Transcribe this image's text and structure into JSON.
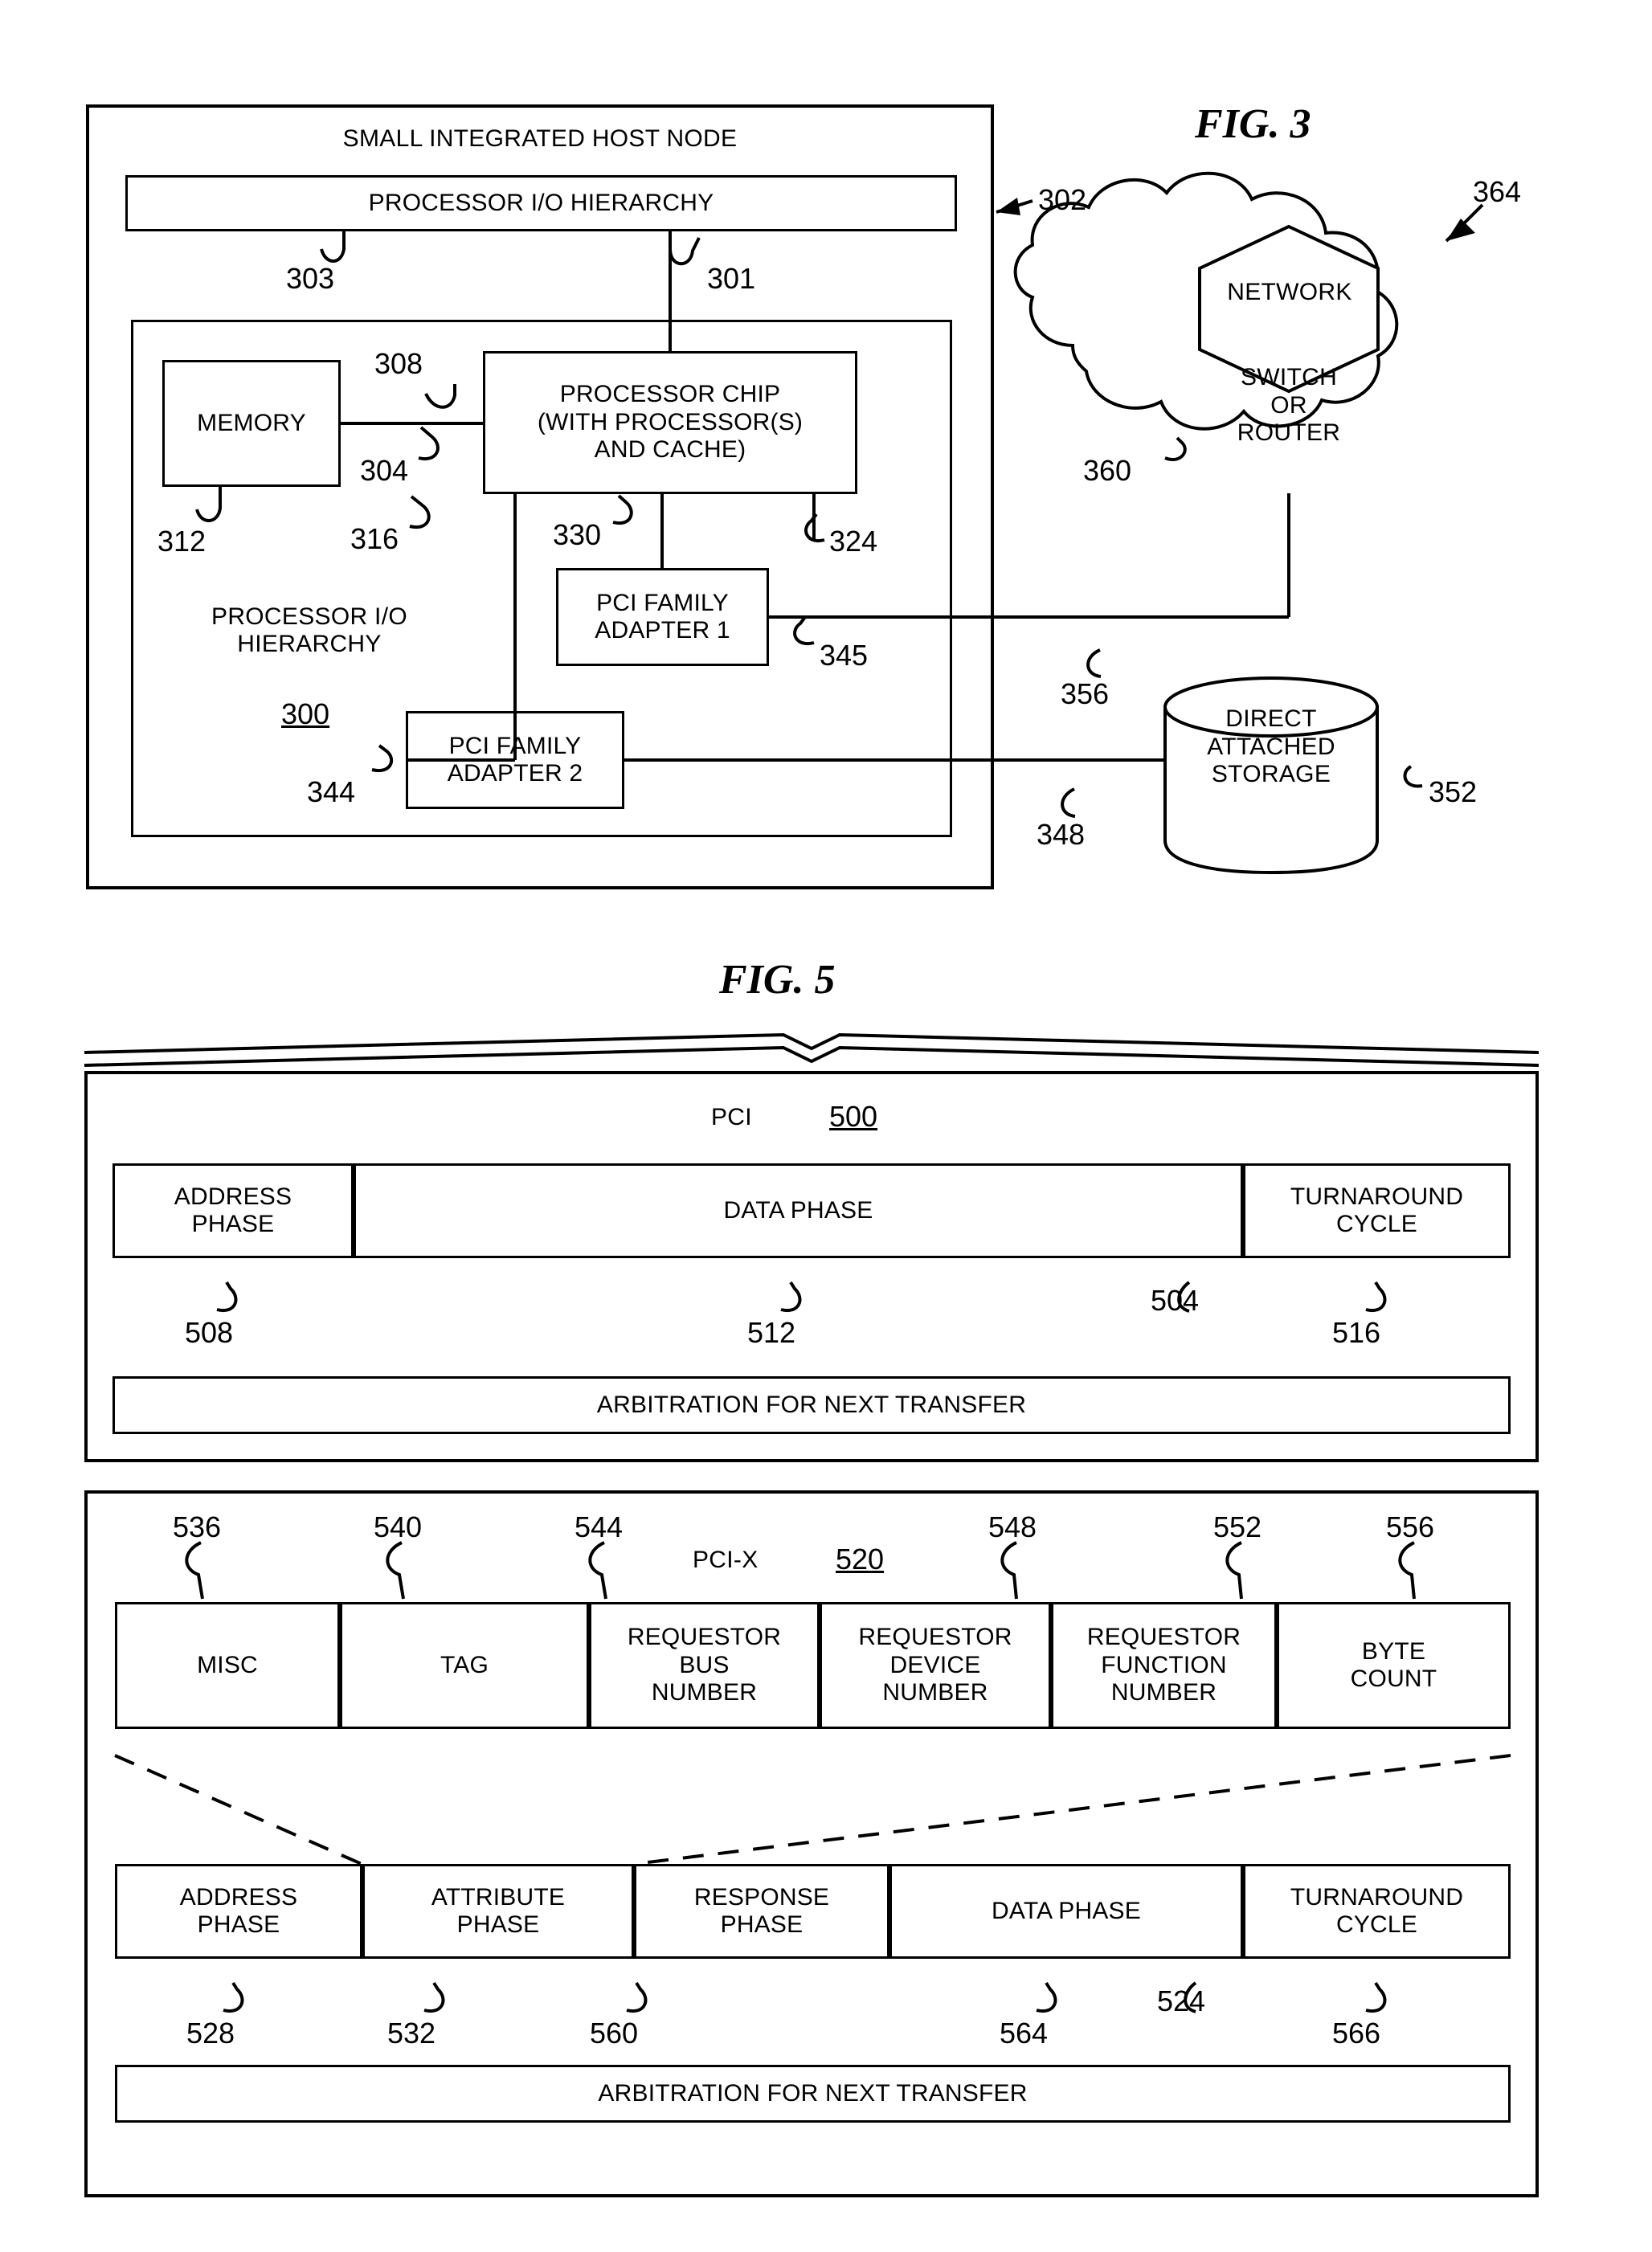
{
  "figures": {
    "fig3": {
      "title": "FIG. 3",
      "outer_label": "SMALL INTEGRATED HOST NODE",
      "processor_io_hierarchy_top": "PROCESSOR I/O HIERARCHY",
      "memory": "MEMORY",
      "processor_chip": "PROCESSOR CHIP\n(WITH PROCESSOR(S)\nAND CACHE)",
      "pci_adapter_1": "PCI FAMILY\nADAPTER 1",
      "pci_adapter_2": "PCI FAMILY\nADAPTER 2",
      "processor_io_hierarchy_inner": "PROCESSOR I/O\nHIERARCHY",
      "hierarchy_number": "300",
      "network": "NETWORK",
      "switch_or_router": "SWITCH\nOR\nROUTER",
      "direct_attached_storage": "DIRECT\nATTACHED\nSTORAGE",
      "refs": {
        "r302": "302",
        "r303": "303",
        "r301": "301",
        "r308": "308",
        "r304": "304",
        "r312": "312",
        "r316": "316",
        "r330": "330",
        "r324": "324",
        "r345": "345",
        "r344": "344",
        "r364": "364",
        "r360": "360",
        "r356": "356",
        "r348": "348",
        "r352": "352"
      }
    },
    "fig5": {
      "title": "FIG. 5",
      "pci": {
        "label": "PCI",
        "number": "500",
        "cells": [
          {
            "text": "ADDRESS\nPHASE",
            "ref": "508"
          },
          {
            "text": "DATA PHASE",
            "ref": "512"
          },
          {
            "text": "TURNAROUND\nCYCLE",
            "ref": "516"
          }
        ],
        "row_ref": "504",
        "arbitration": "ARBITRATION FOR NEXT TRANSFER"
      },
      "pcix": {
        "label": "PCI-X",
        "number": "520",
        "attribute_cells": [
          {
            "text": "MISC",
            "ref": "536"
          },
          {
            "text": "TAG",
            "ref": "540"
          },
          {
            "text": "REQUESTOR\nBUS\nNUMBER",
            "ref": "544"
          },
          {
            "text": "REQUESTOR\nDEVICE\nNUMBER",
            "ref": "548"
          },
          {
            "text": "REQUESTOR\nFUNCTION\nNUMBER",
            "ref": "552"
          },
          {
            "text": "BYTE\nCOUNT",
            "ref": "556"
          }
        ],
        "phase_cells": [
          {
            "text": "ADDRESS\nPHASE",
            "ref": "528"
          },
          {
            "text": "ATTRIBUTE\nPHASE",
            "ref": "532"
          },
          {
            "text": "RESPONSE\nPHASE",
            "ref": "560"
          },
          {
            "text": "DATA PHASE",
            "ref": "564"
          },
          {
            "text": "TURNAROUND\nCYCLE",
            "ref": "566"
          }
        ],
        "row_ref": "524",
        "arbitration": "ARBITRATION FOR NEXT TRANSFER"
      }
    }
  }
}
